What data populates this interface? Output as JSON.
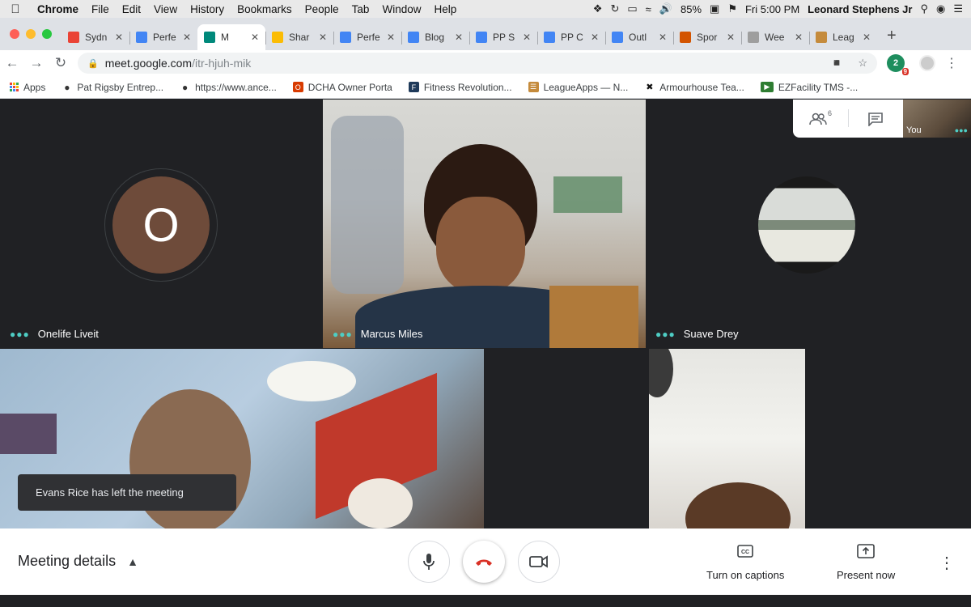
{
  "menubar": {
    "app": "Chrome",
    "menus": [
      "File",
      "Edit",
      "View",
      "History",
      "Bookmarks",
      "People",
      "Tab",
      "Window",
      "Help"
    ],
    "battery": "85%",
    "clock": "Fri 5:00 PM",
    "user": "Leonard Stephens Jr"
  },
  "tabs": [
    {
      "title": "Sydn",
      "icon": "gmail-icon",
      "color": "#ea4335"
    },
    {
      "title": "Perfe",
      "icon": "calendar-icon",
      "color": "#4285f4"
    },
    {
      "title": "M",
      "icon": "meet-icon",
      "color": "#00897b"
    },
    {
      "title": "Shar",
      "icon": "drive-icon",
      "color": "#fbbc04"
    },
    {
      "title": "Perfe",
      "icon": "docs-icon",
      "color": "#4285f4"
    },
    {
      "title": "Blog",
      "icon": "docs-icon",
      "color": "#4285f4"
    },
    {
      "title": "PP S",
      "icon": "docs-icon",
      "color": "#4285f4"
    },
    {
      "title": "PP C",
      "icon": "docs-icon",
      "color": "#4285f4"
    },
    {
      "title": "Outl",
      "icon": "docs-icon",
      "color": "#4285f4"
    },
    {
      "title": "Spor",
      "icon": "sports-icon",
      "color": "#d35400"
    },
    {
      "title": "Wee",
      "icon": "w-icon",
      "color": "#9e9e9e"
    },
    {
      "title": "Leag",
      "icon": "clipboard-icon",
      "color": "#c58b3c"
    }
  ],
  "address": {
    "host": "meet.google.com",
    "path": "/itr-hjuh-mik",
    "extension_badge": "9"
  },
  "bookmarks": [
    {
      "label": "Apps",
      "icon": "apps-grid-icon"
    },
    {
      "label": "Pat Rigsby Entrep...",
      "icon": "globe-icon"
    },
    {
      "label": "https://www.ance...",
      "icon": "globe-icon"
    },
    {
      "label": "DCHA Owner Porta",
      "icon": "office-icon"
    },
    {
      "label": "Fitness Revolution...",
      "icon": "fitness-icon"
    },
    {
      "label": "LeagueApps — N...",
      "icon": "clipboard-icon"
    },
    {
      "label": "Armourhouse Tea...",
      "icon": "armour-icon"
    },
    {
      "label": "EZFacility TMS -...",
      "icon": "ezfacility-icon"
    }
  ],
  "participants": {
    "p1": {
      "name": "Onelife Liveit",
      "initial": "O",
      "avatar_color": "#6e4b3a"
    },
    "p2": {
      "name": "Marcus Miles"
    },
    "p3": {
      "name": "Suave Drey"
    }
  },
  "people_panel": {
    "count": "6"
  },
  "self_view": {
    "label": "You"
  },
  "toast": {
    "text": "Evans Rice has left the meeting"
  },
  "controls": {
    "meeting_details": "Meeting details",
    "captions": "Turn on captions",
    "present": "Present now"
  },
  "colors": {
    "hangup": "#d93025",
    "accent": "#4ecdc4"
  }
}
